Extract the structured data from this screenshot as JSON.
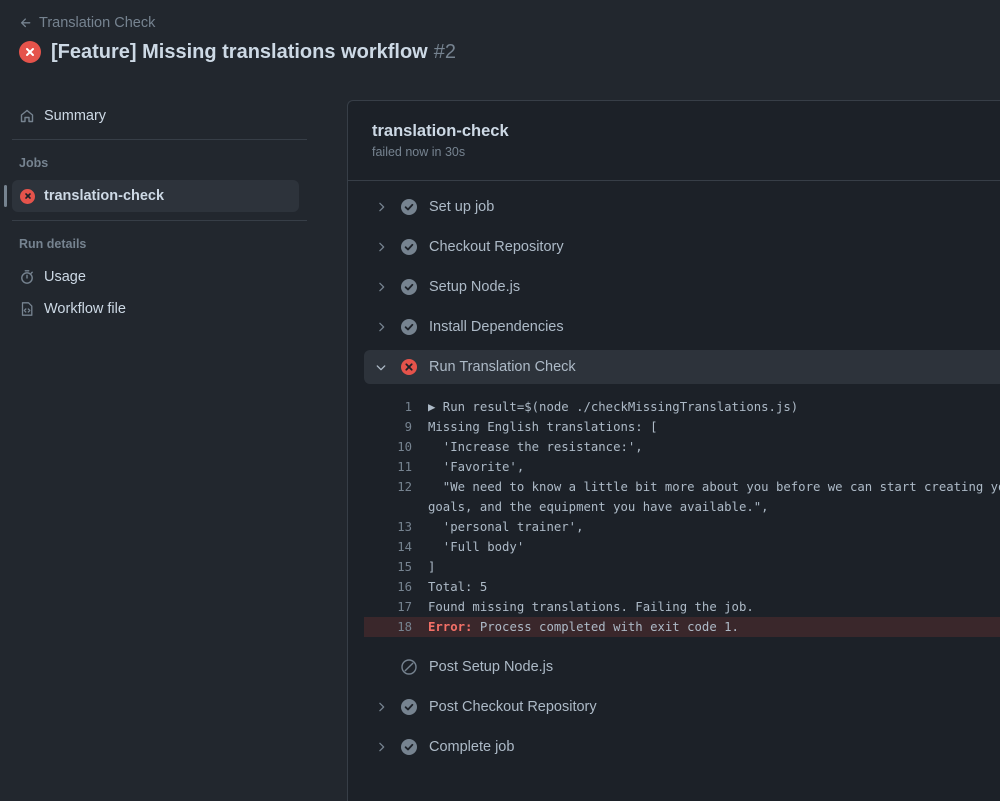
{
  "header": {
    "back_label": "Translation Check",
    "title": "[Feature] Missing translations workflow",
    "run_number": "#2"
  },
  "sidebar": {
    "summary_label": "Summary",
    "jobs_heading": "Jobs",
    "job_label": "translation-check",
    "run_details_heading": "Run details",
    "usage_label": "Usage",
    "workflow_file_label": "Workflow file"
  },
  "job": {
    "name": "translation-check",
    "status": "failed now in 30s"
  },
  "steps": [
    {
      "label": "Set up job",
      "status": "success",
      "expandable": true
    },
    {
      "label": "Checkout Repository",
      "status": "success",
      "expandable": true
    },
    {
      "label": "Setup Node.js",
      "status": "success",
      "expandable": true
    },
    {
      "label": "Install Dependencies",
      "status": "success",
      "expandable": true
    },
    {
      "label": "Run Translation Check",
      "status": "failure",
      "expandable": true,
      "expanded": true
    },
    {
      "label": "Post Setup Node.js",
      "status": "skipped",
      "expandable": false
    },
    {
      "label": "Post Checkout Repository",
      "status": "success",
      "expandable": true
    },
    {
      "label": "Complete job",
      "status": "success",
      "expandable": true
    }
  ],
  "log": {
    "lines": [
      {
        "num": "1",
        "text": "▶ Run result=$(node ./checkMissingTranslations.js)"
      },
      {
        "num": "9",
        "text": "Missing English translations: ["
      },
      {
        "num": "10",
        "text": "  'Increase the resistance:',"
      },
      {
        "num": "11",
        "text": "  'Favorite',"
      },
      {
        "num": "12",
        "text": "  \"We need to know a little bit more about you before we can start creating you"
      },
      {
        "num": "",
        "text": "goals, and the equipment you have available.\","
      },
      {
        "num": "13",
        "text": "  'personal trainer',"
      },
      {
        "num": "14",
        "text": "  'Full body'"
      },
      {
        "num": "15",
        "text": "]"
      },
      {
        "num": "16",
        "text": "Total: 5"
      },
      {
        "num": "17",
        "text": "Found missing translations. Failing the job."
      }
    ],
    "error_line": {
      "num": "18",
      "keyword": "Error:",
      "text": " Process completed with exit code 1."
    }
  },
  "colors": {
    "failure": "#e5534b",
    "success": "#768390",
    "background": "#22272e"
  }
}
